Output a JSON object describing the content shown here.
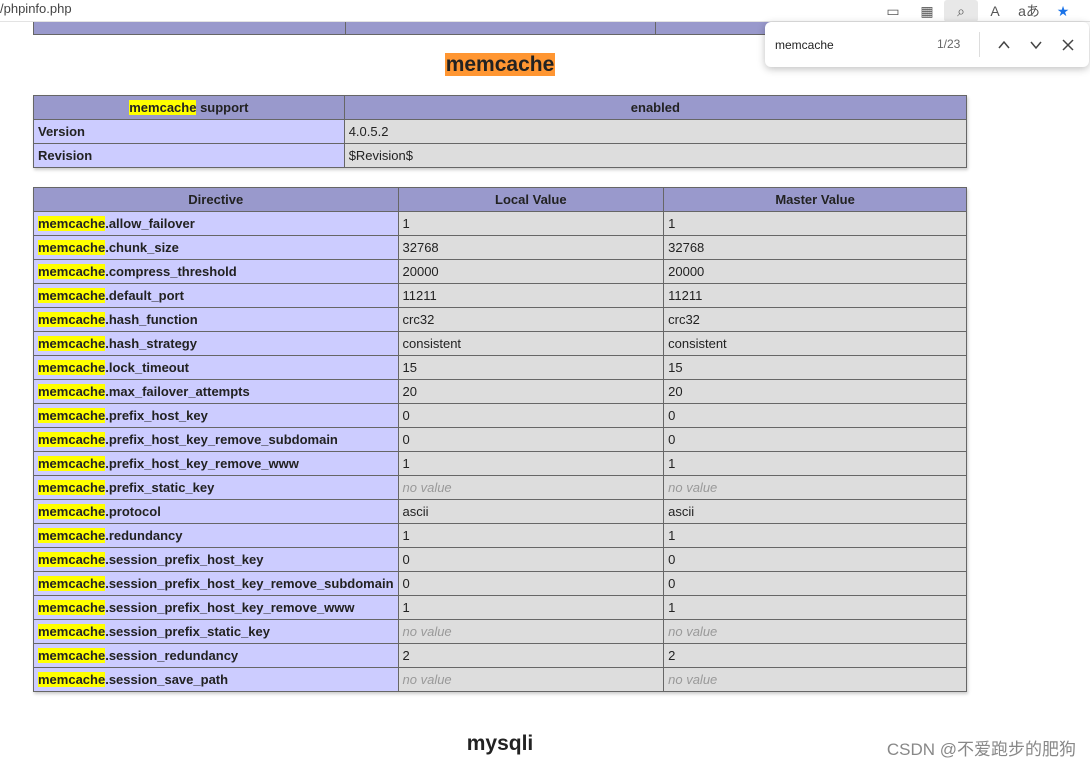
{
  "browser": {
    "url": "/phpinfo.php",
    "toolbar_icons": [
      "immersive-reader-icon",
      "split-screen-icon",
      "find-icon",
      "read-aloud-icon",
      "translate-icon",
      "favorite-star-icon"
    ]
  },
  "find_bar": {
    "query": "memcache",
    "count": "1/23"
  },
  "memcache_section": {
    "title": "memcache"
  },
  "support_table": {
    "header_highlight": "memcache",
    "header_rest": " support",
    "header_value": "enabled",
    "rows": [
      {
        "name": "Version",
        "value": "4.0.5.2"
      },
      {
        "name": "Revision",
        "value": "$Revision$"
      }
    ]
  },
  "directive_table": {
    "headers": [
      "Directive",
      "Local Value",
      "Master Value"
    ],
    "prefix": "memcache",
    "rows": [
      {
        "suffix": ".allow_failover",
        "local": "1",
        "master": "1"
      },
      {
        "suffix": ".chunk_size",
        "local": "32768",
        "master": "32768"
      },
      {
        "suffix": ".compress_threshold",
        "local": "20000",
        "master": "20000"
      },
      {
        "suffix": ".default_port",
        "local": "11211",
        "master": "11211"
      },
      {
        "suffix": ".hash_function",
        "local": "crc32",
        "master": "crc32"
      },
      {
        "suffix": ".hash_strategy",
        "local": "consistent",
        "master": "consistent"
      },
      {
        "suffix": ".lock_timeout",
        "local": "15",
        "master": "15"
      },
      {
        "suffix": ".max_failover_attempts",
        "local": "20",
        "master": "20"
      },
      {
        "suffix": ".prefix_host_key",
        "local": "0",
        "master": "0"
      },
      {
        "suffix": ".prefix_host_key_remove_subdomain",
        "local": "0",
        "master": "0"
      },
      {
        "suffix": ".prefix_host_key_remove_www",
        "local": "1",
        "master": "1"
      },
      {
        "suffix": ".prefix_static_key",
        "local": "no value",
        "master": "no value",
        "novalue": true
      },
      {
        "suffix": ".protocol",
        "local": "ascii",
        "master": "ascii"
      },
      {
        "suffix": ".redundancy",
        "local": "1",
        "master": "1"
      },
      {
        "suffix": ".session_prefix_host_key",
        "local": "0",
        "master": "0"
      },
      {
        "suffix": ".session_prefix_host_key_remove_subdomain",
        "local": "0",
        "master": "0"
      },
      {
        "suffix": ".session_prefix_host_key_remove_www",
        "local": "1",
        "master": "1"
      },
      {
        "suffix": ".session_prefix_static_key",
        "local": "no value",
        "master": "no value",
        "novalue": true
      },
      {
        "suffix": ".session_redundancy",
        "local": "2",
        "master": "2"
      },
      {
        "suffix": ".session_save_path",
        "local": "no value",
        "master": "no value",
        "novalue": true
      }
    ]
  },
  "mysqli_section": {
    "title": "mysqli"
  },
  "watermark": "CSDN @不爱跑步的肥狗",
  "colors": {
    "header_bg": "#9999cc",
    "directive_bg": "#ccccff",
    "value_bg": "#dddddd",
    "highlight_yellow": "#ffff00",
    "highlight_orange": "#ff9632"
  }
}
